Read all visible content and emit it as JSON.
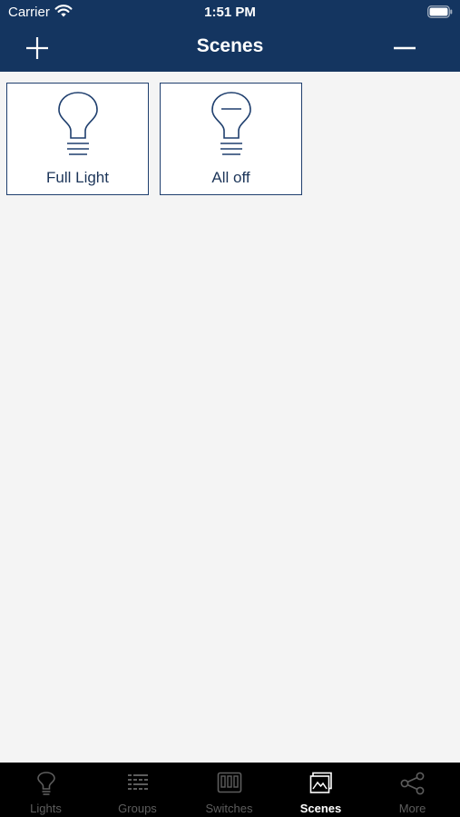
{
  "status_bar": {
    "carrier": "Carrier",
    "time": "1:51 PM",
    "wifi_icon": "wifi-icon",
    "battery_icon": "battery-icon"
  },
  "nav": {
    "title": "Scenes",
    "left_button_icon": "plus-icon",
    "right_button_icon": "minus-icon"
  },
  "scenes": [
    {
      "label": "Full Light",
      "icon": "lightbulb-icon"
    },
    {
      "label": "All off",
      "icon": "lightbulb-off-icon"
    }
  ],
  "tabs": [
    {
      "label": "Lights",
      "icon": "lightbulb-icon",
      "active": false
    },
    {
      "label": "Groups",
      "icon": "groups-grid-icon",
      "active": false
    },
    {
      "label": "Switches",
      "icon": "switch-panel-icon",
      "active": false
    },
    {
      "label": "Scenes",
      "icon": "scenes-picture-icon",
      "active": true
    },
    {
      "label": "More",
      "icon": "share-nodes-icon",
      "active": false
    }
  ],
  "colors": {
    "header_bg": "#143560",
    "tile_border": "#1f3f6e",
    "page_bg": "#f4f4f4",
    "tabbar_bg": "#000000",
    "tab_active": "#ffffff",
    "tab_inactive": "#5d5d5d"
  }
}
